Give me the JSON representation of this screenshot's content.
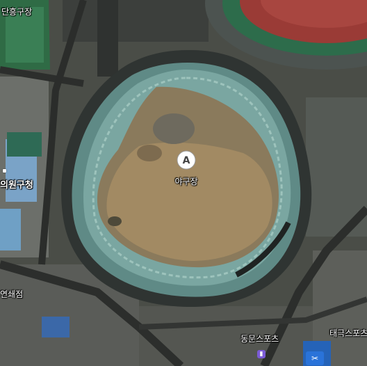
{
  "map": {
    "view": "satellite",
    "marker": {
      "letter": "A",
      "name": "야구장"
    },
    "labels": {
      "top_left": "단흥구장",
      "left_office": "의원구청",
      "left_bottom": "연쇄점",
      "bottom_center": "동문스포츠",
      "bottom_right": "태극스포츠"
    }
  },
  "colors": {
    "marker_fill": "#ffffff",
    "marker_letter": "#444444",
    "poi_purple": "#7b5bd6",
    "poi_blue": "#2a73d9"
  }
}
